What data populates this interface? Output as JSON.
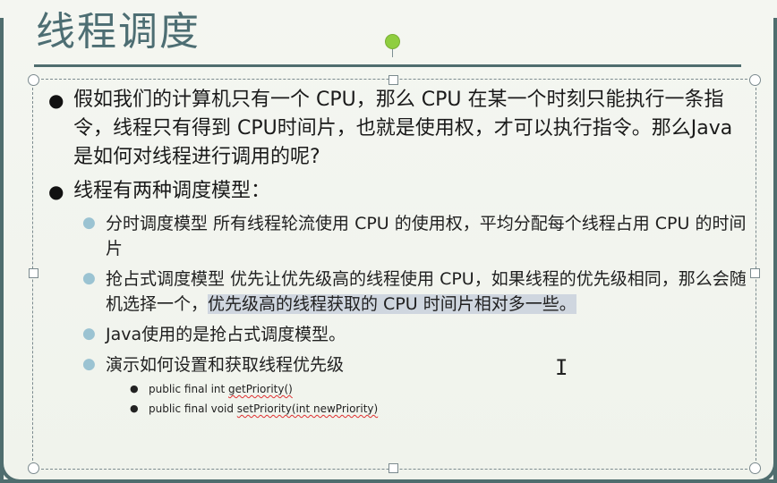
{
  "slide": {
    "title": "线程调度",
    "bullets": [
      {
        "text": "假如我们的计算机只有一个 CPU，那么 CPU 在某一个时刻只能执行一条指令，线程只有得到 CPU时间片，也就是使用权，才可以执行指令。那么Java是如何对线程进行调用的呢?"
      },
      {
        "text": "线程有两种调度模型：",
        "sub": [
          {
            "text": "分时调度模型 所有线程轮流使用 CPU 的使用权，平均分配每个线程占用 CPU 的时间片"
          },
          {
            "text_before": "抢占式调度模型 优先让优先级高的线程使用 CPU，如果线程的优先级相同，那么会随机选择一个，",
            "highlight": "优先级高的线程获取的 CPU 时间片相对多一些。"
          },
          {
            "text": "Java使用的是抢占式调度模型。"
          },
          {
            "text": "演示如何设置和获取线程优先级",
            "sub": [
              {
                "prefix": "public final int ",
                "method": "getPriority()"
              },
              {
                "prefix": "public final void ",
                "method": "setPriority(int newPriority)"
              }
            ]
          }
        ]
      }
    ]
  },
  "colors": {
    "title": "#4d6e73",
    "rule": "#4f6d6e",
    "highlight": "#cfd6df",
    "rotate_handle": "#8fce3f",
    "sub_bullet": "#9bc3d2",
    "spell_error": "#e03030"
  },
  "icons": {
    "cursor": "text-cursor-icon",
    "bullet": "bullet-dot-icon"
  },
  "cursor_glyph": "I"
}
